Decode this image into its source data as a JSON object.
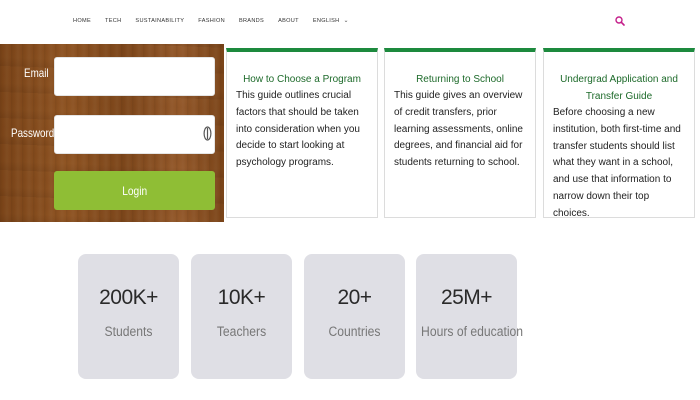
{
  "nav": {
    "items": [
      "HOME",
      "TECH",
      "SUSTAINABILITY",
      "FASHION",
      "BRANDS",
      "ABOUT"
    ],
    "language": "ENGLISH",
    "search_icon": "search-icon",
    "accent_color": "#c41e8a"
  },
  "login": {
    "email_label": "Email",
    "email_value": "",
    "password_label": "Password",
    "password_value": "",
    "password_toggle_icon": "eye-icon",
    "button_label": "Login",
    "button_color": "#8fbe35"
  },
  "cards": [
    {
      "title": "How to Choose a Program",
      "body": "This guide outlines crucial factors that should be taken into consideration when you decide to start looking at psychology programs."
    },
    {
      "title": "Returning to School",
      "body": "This guide gives an overview of credit transfers, prior learning assessments, online degrees, and financial aid for students returning to school."
    },
    {
      "title": "Undergrad Application and Transfer Guide",
      "body": "Before choosing a new institution, both first-time and transfer students should list what they want in a school, and use that information to narrow down their top choices."
    }
  ],
  "card_accent_color": "#1d8a3e",
  "stats": [
    {
      "value": "200K+",
      "label": "Students"
    },
    {
      "value": "10K+",
      "label": "Teachers"
    },
    {
      "value": "20+",
      "label": "Countries"
    },
    {
      "value": "25M+",
      "label": "Hours of education"
    }
  ]
}
